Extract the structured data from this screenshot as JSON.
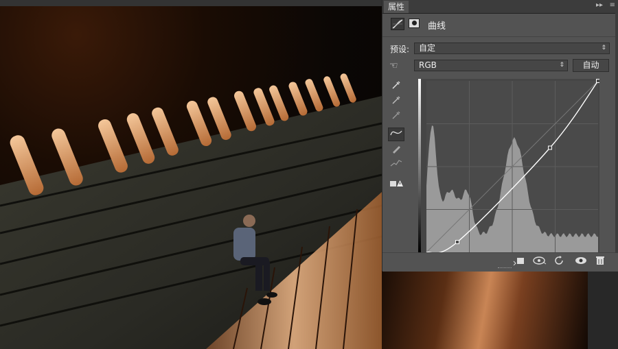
{
  "panel": {
    "tab_label": "属性",
    "collapse_glyph": "▸▸",
    "menu_glyph": "≡",
    "title": "曲线",
    "preset_label": "预设:",
    "preset_value": "自定",
    "channel_value": "RGB",
    "auto_label": "自动",
    "icons": [
      "curves-adjustment-icon",
      "layer-mask-icon",
      "hand-targeted-adjustment-icon",
      "white-point-eyedropper-icon",
      "gray-point-eyedropper-icon",
      "black-point-eyedropper-icon",
      "curve-point-tool-icon",
      "pencil-draw-icon",
      "smooth-curve-icon",
      "clipping-warning-icon",
      "clip-to-layer-icon",
      "view-previous-state-icon",
      "reset-icon",
      "visibility-eye-icon",
      "delete-trash-icon"
    ]
  },
  "curve": {
    "points": [
      [
        0,
        0
      ],
      [
        18,
        6
      ],
      [
        72,
        61
      ],
      [
        100,
        100
      ]
    ]
  },
  "colors": {
    "panel_bg": "#535353",
    "graph_bg": "#454545",
    "histogram": "#9a9a9a",
    "curve": "#ffffff"
  }
}
